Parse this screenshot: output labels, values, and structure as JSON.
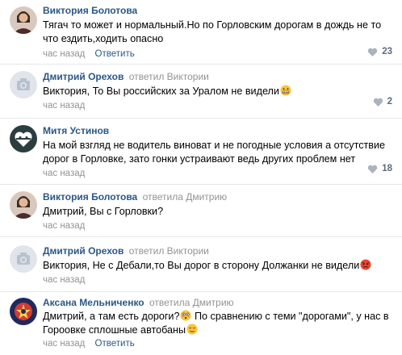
{
  "comments": [
    {
      "author": "Виктория Болотова",
      "reply_to": "",
      "text_lines": [
        "Тягач то может и нормальный.Но по Горловским дорогам в дождь не то",
        "что ездить,ходить опасно"
      ],
      "time": "час назад",
      "reply_label": "Ответить",
      "likes": "23",
      "avatar": "photo-avatar"
    },
    {
      "author": "Дмитрий Орехов",
      "reply_to": "ответил Виктории",
      "text_lines": [
        "Виктория, То Вы российских за Уралом не видели"
      ],
      "emoji": "grimacing-emoji",
      "time": "час назад",
      "reply_label": "",
      "likes": "2",
      "avatar": "camera-avatar"
    },
    {
      "author": "Митя Устинов",
      "reply_to": "",
      "text_lines": [
        "На мой взгляд не водитель виноват и не погодные условия а отсутствие",
        "дорог в Горловке, зато гонки устраивают ведь других проблем нет"
      ],
      "time": "час назад",
      "reply_label": "",
      "likes": "18",
      "avatar": "heart-avatar"
    },
    {
      "author": "Виктория Болотова",
      "reply_to": "ответила Дмитрию",
      "text_lines": [
        "Дмитрий, Вы с Горловки?"
      ],
      "time": "час назад",
      "reply_label": "",
      "likes": "",
      "avatar": "photo-avatar"
    },
    {
      "author": "Дмитрий Орехов",
      "reply_to": "ответил Виктории",
      "text_lines": [
        "Виктория, Не с Дебали,то Вы дорог в сторону Должанки не видели"
      ],
      "emoji": "angry-emoji",
      "time": "час назад",
      "reply_label": "",
      "likes": "",
      "avatar": "camera-avatar"
    },
    {
      "author": "Аксана Мельниченко",
      "reply_to": "ответила Дмитрию",
      "text_lines": [
        "Дмитрий, а там есть дороги?",
        "Гороовке сплошные автобаны"
      ],
      "text_mid": "По сравнению с теми \"дорогами\", у нас в",
      "time": "час назад",
      "reply_label": "Ответить",
      "likes": "",
      "avatar": "emblem-avatar"
    }
  ],
  "colors": {
    "link": "#2a5885",
    "muted": "#939393",
    "divider": "#e7e8ec"
  }
}
